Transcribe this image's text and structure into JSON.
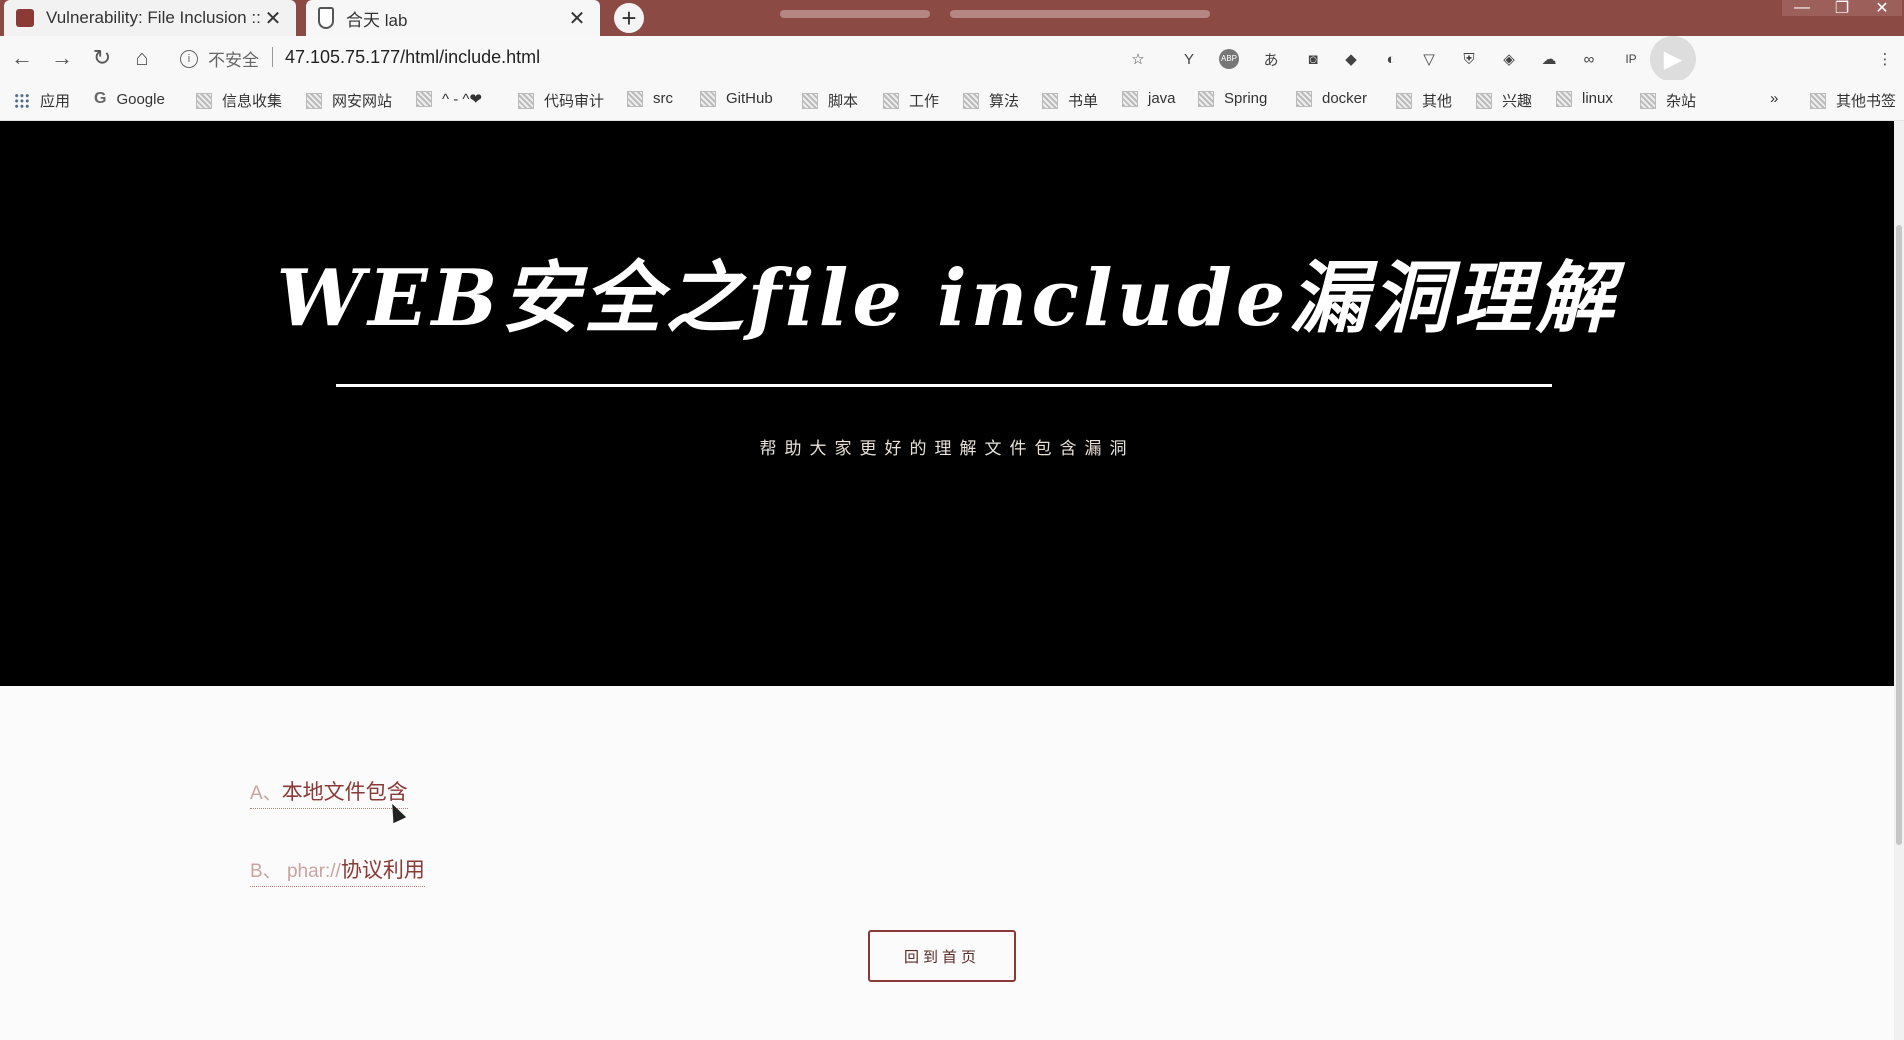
{
  "browser": {
    "tabs": [
      {
        "title": "Vulnerability: File Inclusion :: D",
        "active": true
      },
      {
        "title": "合天 lab",
        "active": false
      }
    ],
    "new_tab": "+",
    "address": {
      "security_label": "不安全",
      "url": "47.105.75.177/html/include.html"
    },
    "bookmarks": [
      {
        "label": "应用",
        "icon": "apps-icon"
      },
      {
        "label": "Google",
        "icon": "google-icon"
      },
      {
        "label": "信息收集",
        "icon": "folder-icon"
      },
      {
        "label": "网安网站",
        "icon": "folder-icon"
      },
      {
        "label": "^ - ^❤",
        "icon": "folder-icon"
      },
      {
        "label": "代码审计",
        "icon": "folder-icon"
      },
      {
        "label": "src",
        "icon": "folder-icon"
      },
      {
        "label": "GitHub",
        "icon": "folder-icon"
      },
      {
        "label": "脚本",
        "icon": "folder-icon"
      },
      {
        "label": "工作",
        "icon": "folder-icon"
      },
      {
        "label": "算法",
        "icon": "folder-icon"
      },
      {
        "label": "书单",
        "icon": "folder-icon"
      },
      {
        "label": "java",
        "icon": "folder-icon"
      },
      {
        "label": "Spring",
        "icon": "folder-icon"
      },
      {
        "label": "docker",
        "icon": "folder-icon"
      },
      {
        "label": "其他",
        "icon": "folder-icon"
      },
      {
        "label": "兴趣",
        "icon": "folder-icon"
      },
      {
        "label": "linux",
        "icon": "folder-icon"
      },
      {
        "label": "杂站",
        "icon": "folder-icon"
      }
    ],
    "overflow": "»",
    "other_bookmarks": "其他书签",
    "extensions": [
      "star-icon",
      "fork-icon",
      "abp-icon",
      "translate-icon",
      "robot-icon",
      "box-icon",
      "swirl-icon",
      "pocket-icon",
      "shield-icon",
      "diamond-icon",
      "cloud-icon",
      "link-icon",
      "ip-icon"
    ]
  },
  "page": {
    "hero_title": "WEB安全之file include漏洞理解",
    "hero_subtitle": "帮助大家更好的理解文件包含漏洞",
    "links": [
      {
        "prefix": "A、",
        "label": "本地文件包含"
      },
      {
        "prefix": "B、 phar://",
        "label": "协议利用"
      }
    ],
    "home_button": "回到首页"
  },
  "colors": {
    "titlebar": "#8c4a45",
    "hero_bg": "#000000",
    "link": "#8a3a36"
  }
}
